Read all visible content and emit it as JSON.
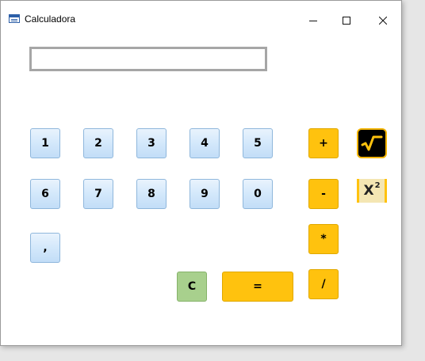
{
  "window": {
    "title": "Calculadora"
  },
  "display": {
    "value": ""
  },
  "keys": {
    "n1": "1",
    "n2": "2",
    "n3": "3",
    "n4": "4",
    "n5": "5",
    "n6": "6",
    "n7": "7",
    "n8": "8",
    "n9": "9",
    "n0": "0",
    "comma": ",",
    "plus": "+",
    "minus": "-",
    "multiply": "*",
    "divide": "/",
    "clear": "C",
    "equals": "="
  },
  "special": {
    "square_base": "X",
    "square_exp": "2"
  },
  "icons": {
    "app": "calculator-window-icon",
    "minimize": "minimize-icon",
    "maximize": "maximize-icon",
    "close": "close-icon",
    "sqrt": "square-root-icon"
  },
  "colors": {
    "number_key": "#d3e8fb",
    "operator_key": "#ffc20e",
    "clear_key": "#a8d08d",
    "sqrt_bg": "#000000",
    "sqrt_symbol": "#ffc20e"
  }
}
